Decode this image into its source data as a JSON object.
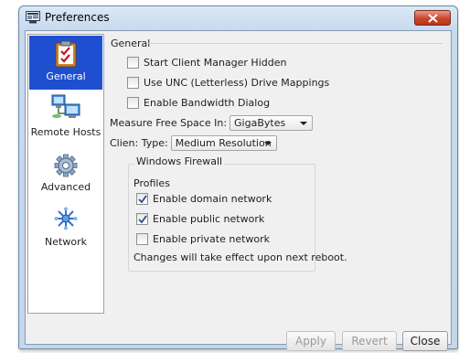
{
  "window": {
    "title": "Preferences"
  },
  "sidebar": {
    "items": [
      {
        "label": "General",
        "icon": "clipboard-check-icon",
        "selected": true
      },
      {
        "label": "Remote Hosts",
        "icon": "computers-icon",
        "selected": false
      },
      {
        "label": "Advanced",
        "icon": "gear-icon",
        "selected": false
      },
      {
        "label": "Network",
        "icon": "network-star-icon",
        "selected": false
      }
    ]
  },
  "general": {
    "title": "General",
    "options": [
      {
        "label": "Start Client Manager Hidden",
        "checked": false
      },
      {
        "label": "Use UNC (Letterless) Drive Mappings",
        "checked": false
      },
      {
        "label": "Enable Bandwidth Dialog",
        "checked": false
      }
    ],
    "free_space": {
      "label": "Measure Free Space In:",
      "value": "GigaBytes"
    },
    "client_type": {
      "label": "Clien: Type:",
      "value": "Medium Resolution"
    }
  },
  "firewall": {
    "title": "Windows Firewall",
    "profiles_label": "Profiles",
    "options": [
      {
        "label": "Enable domain network",
        "checked": true
      },
      {
        "label": "Enable public network",
        "checked": true
      },
      {
        "label": "Enable private network",
        "checked": false
      }
    ],
    "note": "Changes will take effect upon next reboot."
  },
  "footer": {
    "apply": "Apply",
    "revert": "Revert",
    "close": "Close"
  },
  "colors": {
    "selection": "#1f4fd1",
    "close_button": "#c9462b"
  }
}
